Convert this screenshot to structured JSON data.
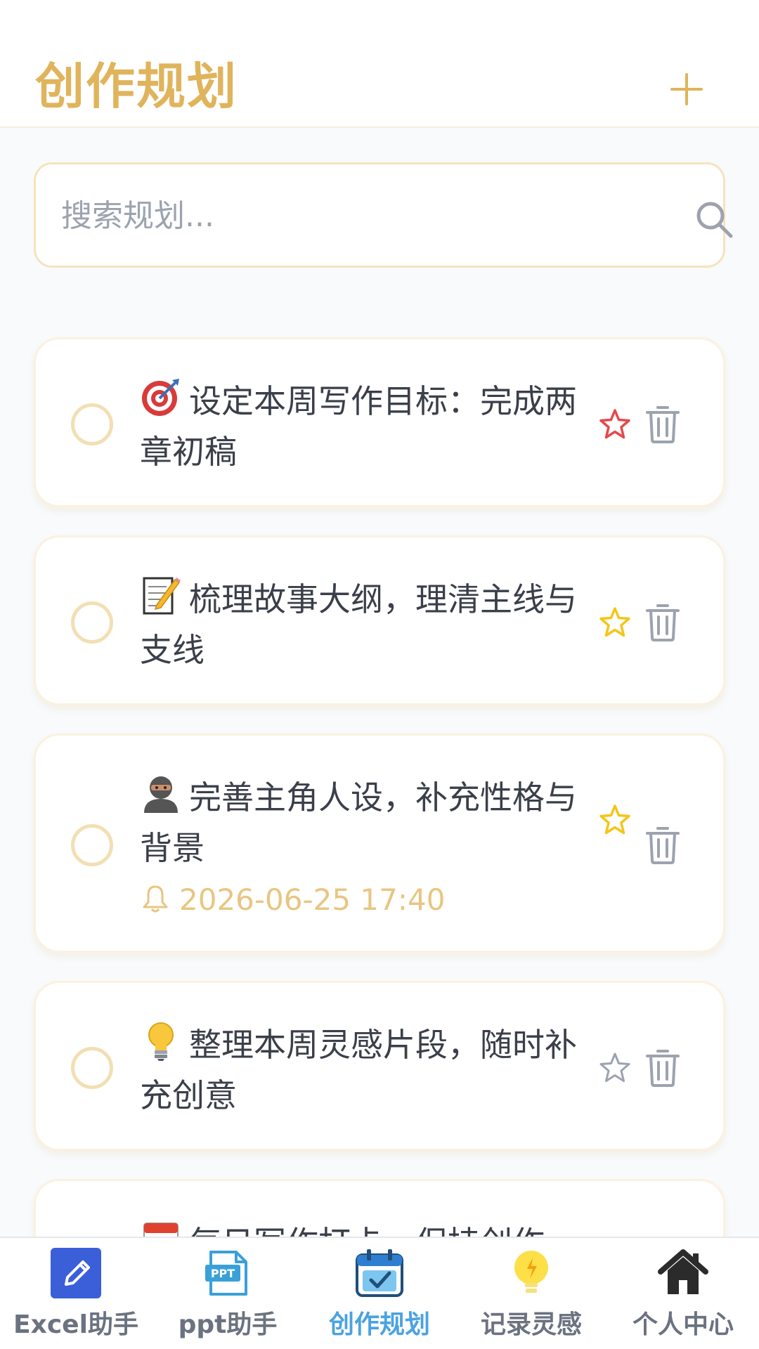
{
  "header": {
    "title": "创作规划",
    "add_icon": "plus-icon"
  },
  "search": {
    "placeholder": "搜索规划...",
    "value": ""
  },
  "tasks": [
    {
      "emoji": "direct-hit-target",
      "text": "设定本周写作目标：完成两章初稿",
      "starred": true,
      "star_color": "#e5484d",
      "reminder": ""
    },
    {
      "emoji": "memo",
      "text": "梳理故事大纲，理清主线与支线",
      "starred": true,
      "star_color": "#f5c518",
      "reminder": ""
    },
    {
      "emoji": "ninja-person",
      "text": "完善主角人设，补充性格与背景",
      "starred": true,
      "star_color": "#f5c518",
      "reminder": "2026-06-25 17:40"
    },
    {
      "emoji": "light-bulb",
      "text": "整理本周灵感片段，随时补充创意",
      "starred": false,
      "star_color": "#9ca3af",
      "reminder": ""
    },
    {
      "emoji": "calendar",
      "text": "每日写作打卡，保持创作",
      "starred": false,
      "star_color": "#9ca3af",
      "reminder": ""
    }
  ],
  "nav": [
    {
      "label": "Excel助手",
      "icon": "pencil-square-icon",
      "active": false
    },
    {
      "label": "ppt助手",
      "icon": "ppt-file-icon",
      "active": false
    },
    {
      "label": "创作规划",
      "icon": "calendar-check-icon",
      "active": true
    },
    {
      "label": "记录灵感",
      "icon": "light-bulb-icon",
      "active": false
    },
    {
      "label": "个人中心",
      "icon": "house-icon",
      "active": false
    }
  ],
  "colors": {
    "accent": "#e0b45c",
    "active_nav": "#4aa3e0",
    "reminder": "#e8c681"
  }
}
